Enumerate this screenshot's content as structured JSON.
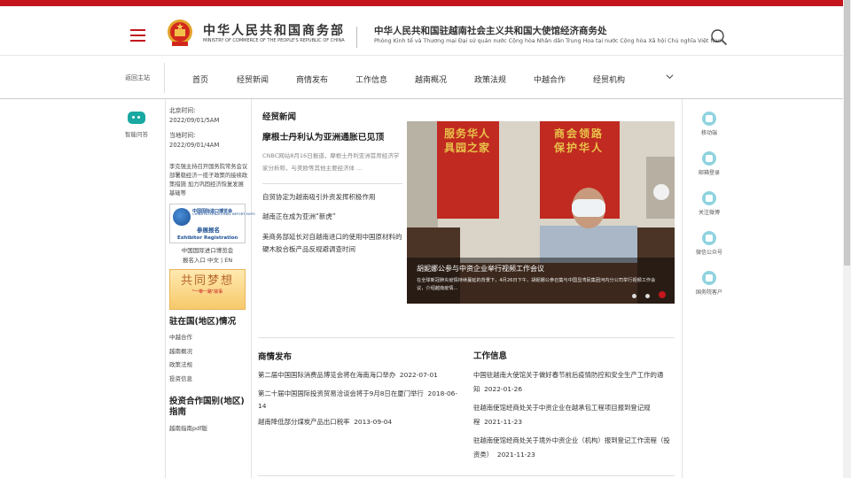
{
  "header": {
    "ministry_cn": "中华人民共和国商务部",
    "ministry_en": "MINISTRY OF COMMERCE OF THE PEOPLE'S REPUBLIC OF CHINA",
    "office_cn": "中华人民共和国驻越南社会主义共和国大使馆经济商务处",
    "office_vn": "Phòng Kinh tế và Thương mại Đại sứ quán nước Cộng hòa Nhân dân Trung Hoa tại nước Cộng hòa Xã hội Chủ nghĩa Việt Nam",
    "brand_color": "#c4161c"
  },
  "nav": {
    "back": "返回主站",
    "items": [
      "首页",
      "经贸新闻",
      "商情发布",
      "工作信息",
      "越南概况",
      "政策法规",
      "中越合作",
      "经贸机构"
    ]
  },
  "left": {
    "smart_qa": "智能问答"
  },
  "side": {
    "bj_label": "北京时间:",
    "bj_time": "2022/09/01/5AM",
    "local_label": "当地时间:",
    "local_time": "2022/09/01/4AM",
    "news": "李克强主持召开国务院常务会议 部署稳经济一揽子政策的接续政策措施 加力巩固经济恢复发展基础等",
    "expo_t1": "中国国际进口博览会",
    "expo_t2": "CHINA INTERNATIONAL IMPORT EXPO",
    "expo_t3": "参展报名",
    "expo_t4": "Exhibitor Registration",
    "expo_caption1": "中国国际进口博览会",
    "expo_caption2": "报名入口 中文 | EN",
    "dream_t1": "共同梦想",
    "dream_t2": "\"一带一路\"故事",
    "region_title": "驻在国(地区)情况",
    "region_links": [
      "中越合作",
      "越南概况",
      "政策法规",
      "投资信息"
    ],
    "invest_title": "投资合作国别(地区)指南",
    "invest_link": "越南指南pdf版"
  },
  "main": {
    "section_title": "经贸新闻",
    "lead_title": "摩根士丹利认为亚洲通胀已见顶",
    "lead_summary": "CNBC网站8月16日报道，摩根士丹利亚洲首席经济学家分析称，与美欧等其他主要经济体 ...",
    "news": [
      "自贸协定为越南吸引外资发挥积极作用",
      "越南正在成为亚洲“新虎”",
      "美商务部延长对自越南进口的使用中国原材料的硬木胶合板产品反规避调查时间"
    ],
    "photo_title": "胡妮娜公参与中资企业举行视频工作会议",
    "photo_desc": "在全球新冠肺炎疫情持续蔓延的背景下，4月26日下午，胡妮娜公参召集与中国显湾民集团河内分公司举行视频工作会议，介绍越南疫情..."
  },
  "shangqing": {
    "title": "商情发布",
    "items": [
      {
        "text": "第二届中国国际消费品博览会将在海南海口举办",
        "date": "2022-07-01"
      },
      {
        "text": "第二十届中国国际投资贸易洽谈会将于9月8日在厦门举行",
        "date": "2018-06-14"
      },
      {
        "text": "越南降低部分煤炭产品出口税率",
        "date": "2013-09-04"
      }
    ]
  },
  "work": {
    "title": "工作信息",
    "items": [
      {
        "text": "中国驻越南大使馆关于做好春节前后疫情防控和安全生产工作的通知",
        "date": "2022-01-26"
      },
      {
        "text": "驻越南使馆经商处关于中资企业在越承包工程项目报到登记规程",
        "date": "2021-11-23"
      },
      {
        "text": "驻越南使馆经商处关于境外中资企业（机构）报到登记工作流程（投资类）",
        "date": "2021-11-23"
      }
    ]
  },
  "right": {
    "items": [
      "移动端",
      "邮箱登录",
      "关注微博",
      "微信公众号",
      "国务院客户"
    ]
  },
  "photo_banner_left": "服务华人 具园之家",
  "photo_banner_right": "商会领路 保护华人"
}
